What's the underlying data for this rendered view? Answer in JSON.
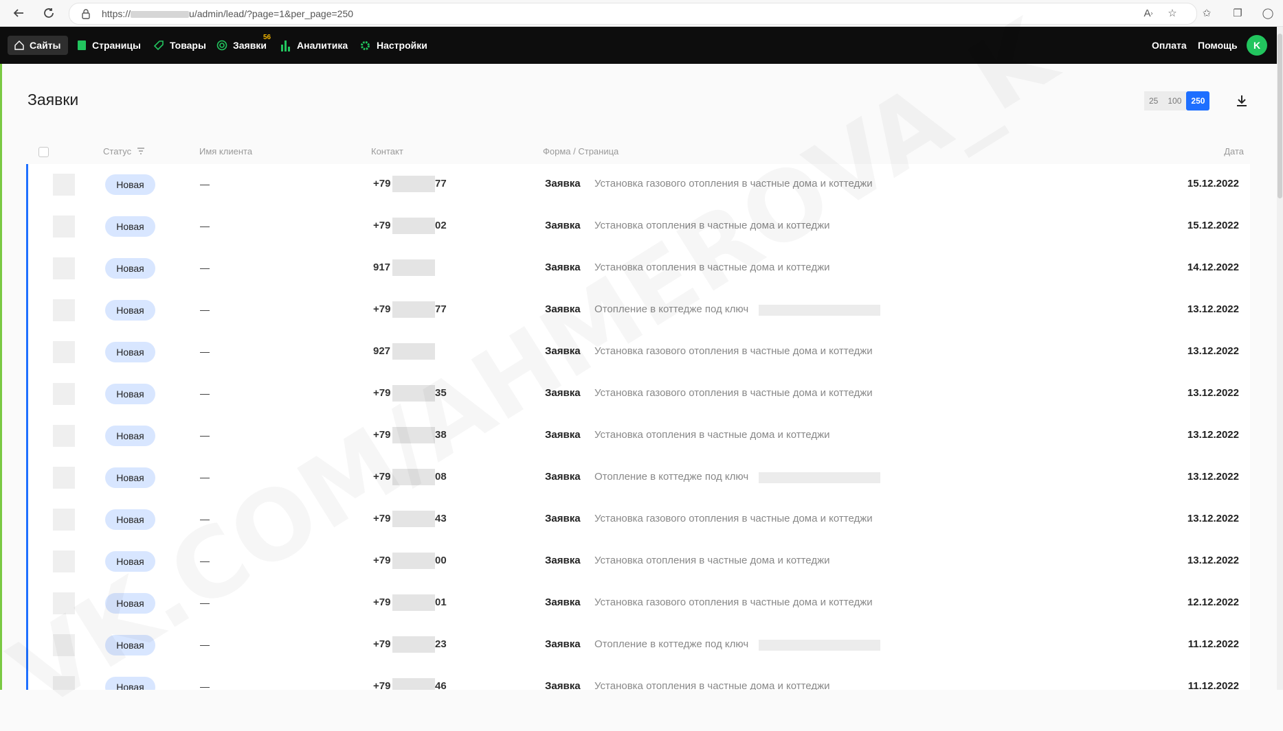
{
  "browser": {
    "url_prefix": "https://",
    "url_suffix": "u/admin/lead/?page=1&per_page=250"
  },
  "nav": {
    "items": [
      {
        "label": "Сайты",
        "icon": "home-icon"
      },
      {
        "label": "Страницы",
        "icon": "pages-icon"
      },
      {
        "label": "Товары",
        "icon": "tag-icon"
      },
      {
        "label": "Заявки",
        "icon": "target-icon",
        "badge": "56"
      },
      {
        "label": "Аналитика",
        "icon": "bar-chart-icon"
      },
      {
        "label": "Настройки",
        "icon": "gear-icon"
      }
    ],
    "payment": "Оплата",
    "help": "Помощь",
    "avatar_letter": "K"
  },
  "page": {
    "title": "Заявки",
    "per_page_options": [
      "25",
      "100",
      "250"
    ],
    "per_page_selected": "250"
  },
  "table": {
    "headers": {
      "status": "Статус",
      "client": "Имя клиента",
      "contact": "Контакт",
      "form_page": "Форма / Страница",
      "date": "Дата"
    },
    "rows": [
      {
        "status": "Новая",
        "name": "—",
        "phone_prefix": "+79",
        "phone_suffix": "77",
        "form": "Заявка",
        "page": "Установка газового отопления в частные дома и коттеджи",
        "date": "15.12.2022"
      },
      {
        "status": "Новая",
        "name": "—",
        "phone_prefix": "+79",
        "phone_suffix": "02",
        "form": "Заявка",
        "page": "Установка отопления в частные дома и коттеджи",
        "date": "15.12.2022"
      },
      {
        "status": "Новая",
        "name": "—",
        "phone_prefix": "917",
        "phone_suffix": "",
        "form": "Заявка",
        "page": "Установка отопления в частные дома и коттеджи",
        "date": "14.12.2022"
      },
      {
        "status": "Новая",
        "name": "—",
        "phone_prefix": "+79",
        "phone_suffix": "77",
        "form": "Заявка",
        "page": "Отопление в коттедже под ключ",
        "date": "13.12.2022"
      },
      {
        "status": "Новая",
        "name": "—",
        "phone_prefix": "927",
        "phone_suffix": "",
        "form": "Заявка",
        "page": "Установка газового отопления в частные дома и коттеджи",
        "date": "13.12.2022"
      },
      {
        "status": "Новая",
        "name": "—",
        "phone_prefix": "+79",
        "phone_suffix": "35",
        "form": "Заявка",
        "page": "Установка газового отопления в частные дома и коттеджи",
        "date": "13.12.2022"
      },
      {
        "status": "Новая",
        "name": "—",
        "phone_prefix": "+79",
        "phone_suffix": "38",
        "form": "Заявка",
        "page": "Установка отопления в частные дома и коттеджи",
        "date": "13.12.2022"
      },
      {
        "status": "Новая",
        "name": "—",
        "phone_prefix": "+79",
        "phone_suffix": "08",
        "form": "Заявка",
        "page": "Отопление в коттедже под ключ",
        "date": "13.12.2022"
      },
      {
        "status": "Новая",
        "name": "—",
        "phone_prefix": "+79",
        "phone_suffix": "43",
        "form": "Заявка",
        "page": "Установка газового отопления в частные дома и коттеджи",
        "date": "13.12.2022"
      },
      {
        "status": "Новая",
        "name": "—",
        "phone_prefix": "+79",
        "phone_suffix": "00",
        "form": "Заявка",
        "page": "Установка отопления в частные дома и коттеджи",
        "date": "13.12.2022"
      },
      {
        "status": "Новая",
        "name": "—",
        "phone_prefix": "+79",
        "phone_suffix": "01",
        "form": "Заявка",
        "page": "Установка газового отопления в частные дома и коттеджи",
        "date": "12.12.2022"
      },
      {
        "status": "Новая",
        "name": "—",
        "phone_prefix": "+79",
        "phone_suffix": "23",
        "form": "Заявка",
        "page": "Отопление в коттедже под ключ",
        "date": "11.12.2022"
      },
      {
        "status": "Новая",
        "name": "—",
        "phone_prefix": "+79",
        "phone_suffix": "46",
        "form": "Заявка",
        "page": "Установка отопления в частные дома и коттеджи",
        "date": "11.12.2022"
      }
    ]
  },
  "watermark": "VK.COM/AHMEROVA_K"
}
